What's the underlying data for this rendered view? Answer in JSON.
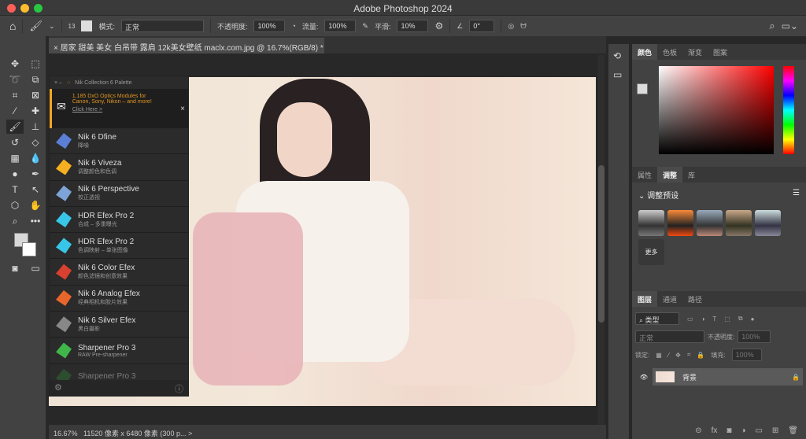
{
  "window": {
    "title": "Adobe Photoshop 2024"
  },
  "options": {
    "brush_size": "13",
    "mode_label": "模式:",
    "mode_value": "正常",
    "opacity_label": "不透明度:",
    "opacity_value": "100%",
    "flow_label": "流量:",
    "flow_value": "100%",
    "smoothing_label": "平滑:",
    "smoothing_value": "10%",
    "angle_value": "0°"
  },
  "document": {
    "tab_title": "居家 甜美 美女 白吊带 露肩 12k美女壁纸 maclx.com.jpg @ 16.7%(RGB/8) *"
  },
  "nik": {
    "title": "Nik Collection 6 Palette",
    "promo_text": "1,185 DxO Optics Modules for Canon, Sony, Nikon – and more!",
    "promo_link": "Click Here >",
    "items": [
      {
        "name": "Nik 6 Dfine",
        "sub": "降噪",
        "color": "#5b7fd6"
      },
      {
        "name": "Nik 6 Viveza",
        "sub": "调整颜色和色调",
        "color": "#f5b021"
      },
      {
        "name": "Nik 6 Perspective",
        "sub": "校正透视",
        "color": "#7ea3d6"
      },
      {
        "name": "HDR Efex Pro 2",
        "sub": "合成 – 多重曝光",
        "color": "#38c6e8"
      },
      {
        "name": "HDR Efex Pro 2",
        "sub": "色调映射 – 单张图像",
        "color": "#38c6e8"
      },
      {
        "name": "Nik 6 Color Efex",
        "sub": "颜色滤镜和创意效果",
        "color": "#d8402f"
      },
      {
        "name": "Nik 6 Analog Efex",
        "sub": "经典相机和胶片效果",
        "color": "#e8662b"
      },
      {
        "name": "Nik 6 Silver Efex",
        "sub": "黑白摄影",
        "color": "#888888"
      },
      {
        "name": "Sharpener Pro 3",
        "sub": "RAW Pre-sharpener",
        "color": "#3fb54a"
      },
      {
        "name": "Sharpener Pro 3",
        "sub": "",
        "color": "#2f7a35"
      }
    ]
  },
  "status": {
    "zoom": "16.67%",
    "info": "11520 像素 x 6480 像素 (300 p...",
    "arrow": ">"
  },
  "panels": {
    "color_tabs": [
      "颜色",
      "色板",
      "渐变",
      "图案"
    ],
    "adjust_tabs": [
      "属性",
      "调整",
      "库"
    ],
    "adjust_presets_label": "调整预设",
    "more_label": "更多",
    "layers_tabs": [
      "图层",
      "通道",
      "路径"
    ],
    "filter_kind": "类型",
    "blend_mode": "正常",
    "opacity_label": "不透明度:",
    "opacity_value": "100%",
    "lock_label": "锁定:",
    "fill_label": "填充:",
    "fill_value": "100%",
    "layer_name": "背景"
  }
}
